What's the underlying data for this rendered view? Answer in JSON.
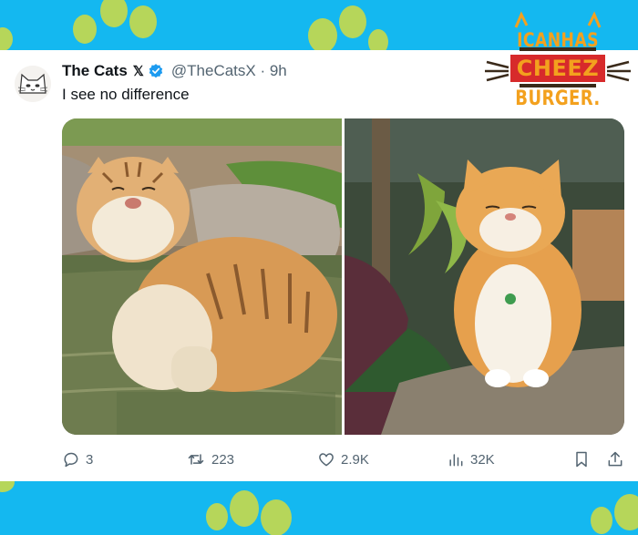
{
  "tweet": {
    "display_name": "The Cats",
    "x_badge": "𝕏",
    "handle_time": "@TheCatsX · 9h",
    "text": "I see no difference"
  },
  "actions": {
    "replies": "3",
    "reposts": "223",
    "likes": "2.9K",
    "views": "32K"
  },
  "watermark": {
    "line1": "ICANHAS",
    "line2": "CHEEZ",
    "line3": "BURGER."
  },
  "icons": {
    "reply": "reply-icon",
    "repost": "repost-icon",
    "like": "heart-icon",
    "views": "views-icon",
    "bookmark": "bookmark-icon",
    "share": "share-icon",
    "verified": "verified-badge-icon"
  },
  "colors": {
    "background": "#14b8f0",
    "paw": "#b6d65a",
    "verified": "#1d9bf0",
    "text": "#0f1419",
    "muted": "#536471",
    "logo_orange": "#f3a11e",
    "logo_red": "#d72a2b"
  }
}
